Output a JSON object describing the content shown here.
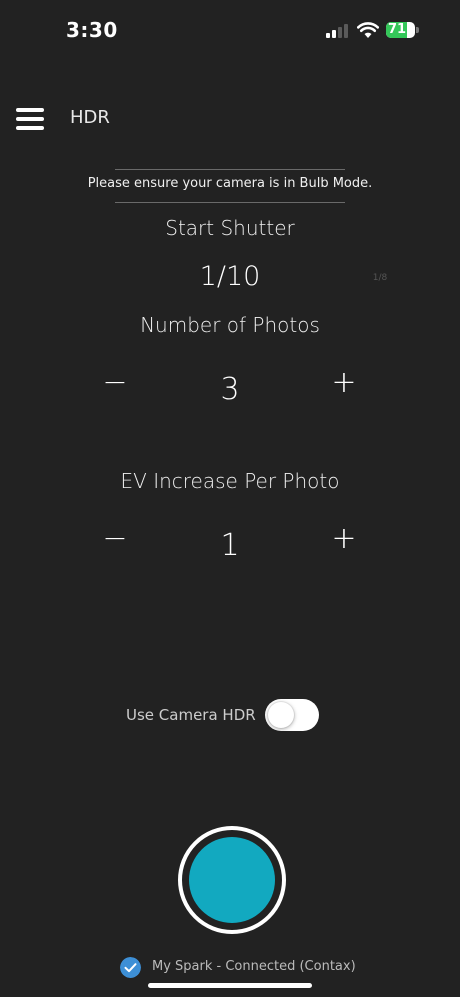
{
  "status_bar": {
    "time": "3:30",
    "battery_percent": 71,
    "battery_label": "71"
  },
  "header": {
    "title": "HDR"
  },
  "notice": "Please ensure your camera is in Bulb Mode.",
  "start_shutter": {
    "label": "Start Shutter",
    "value": "1/10",
    "next_value": "1/8"
  },
  "photos": {
    "label": "Number of Photos",
    "value": "3",
    "decrement": "−",
    "increment": "+"
  },
  "ev": {
    "label": "EV Increase Per Photo",
    "value": "1",
    "decrement": "−",
    "increment": "+"
  },
  "camera_hdr": {
    "label": "Use Camera HDR",
    "enabled": false
  },
  "connection": {
    "text": "My Spark - Connected (Contax)"
  },
  "colors": {
    "background": "#222222",
    "accent": "#12a9c0",
    "connected": "#3d8fd6",
    "battery": "#34c759"
  }
}
